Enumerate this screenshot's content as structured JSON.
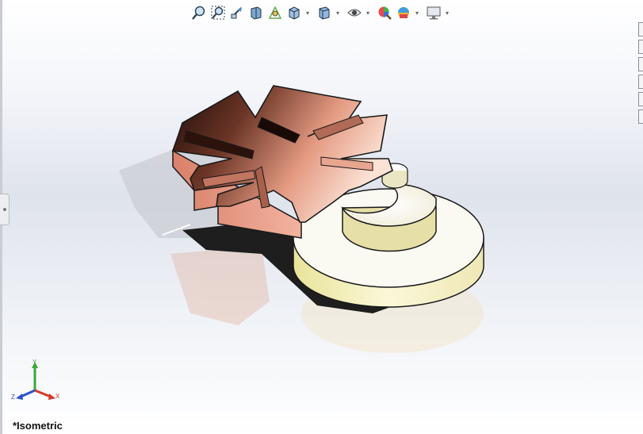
{
  "toolbar": {
    "items": [
      {
        "icon": "zoom-to-fit-icon",
        "dropdown": false
      },
      {
        "icon": "zoom-to-area-icon",
        "dropdown": false
      },
      {
        "icon": "previous-view-icon",
        "dropdown": false
      },
      {
        "icon": "section-view-icon",
        "dropdown": false
      },
      {
        "icon": "dynamic-annotation-views-icon",
        "dropdown": false
      },
      {
        "icon": "view-orientation-icon",
        "dropdown": true
      },
      {
        "icon": "display-style-icon",
        "dropdown": true
      },
      {
        "icon": "hide-show-items-icon",
        "dropdown": true
      },
      {
        "icon": "edit-appearance-icon",
        "dropdown": false
      },
      {
        "icon": "apply-scene-icon",
        "dropdown": true
      },
      {
        "icon": "view-settings-icon",
        "dropdown": true
      }
    ]
  },
  "triad": {
    "x_label": "X",
    "y_label": "Y",
    "z_label": "Z",
    "x_color": "#d23a2a",
    "y_color": "#3aa83a",
    "z_color": "#2a52c9"
  },
  "view": {
    "orientation_label": "*Isometric"
  },
  "colors": {
    "copper_dark": "#3a1a10",
    "copper_light": "#f0a890",
    "cream": "#f4f0c8",
    "edge": "#1a1a1a"
  }
}
